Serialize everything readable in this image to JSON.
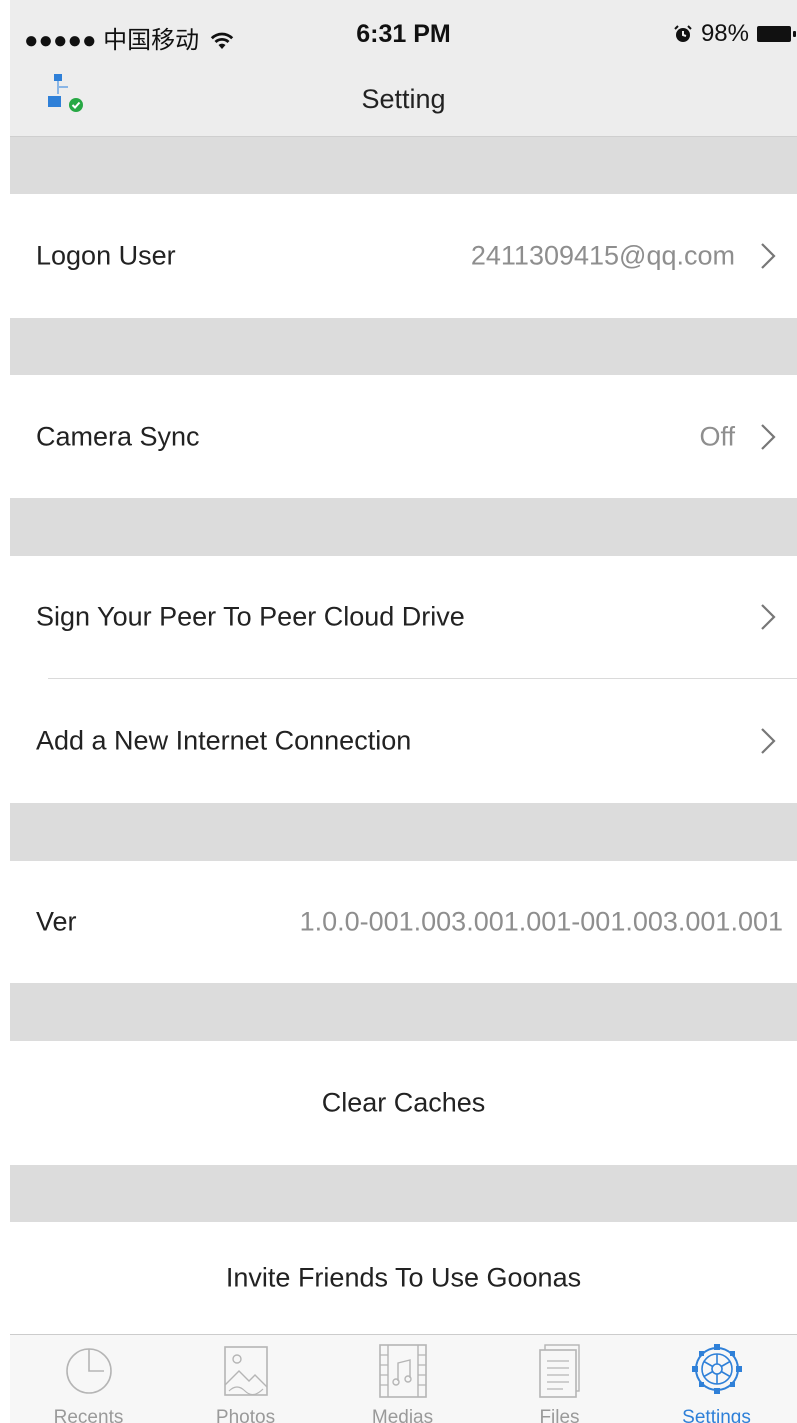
{
  "status_bar": {
    "carrier": "●●●●● 中国移动",
    "time": "6:31 PM",
    "battery": "98%"
  },
  "nav": {
    "title": "Setting"
  },
  "rows": {
    "logon_user": {
      "label": "Logon User",
      "value": "2411309415@qq.com"
    },
    "camera_sync": {
      "label": "Camera Sync",
      "value": "Off"
    },
    "sign_drive": {
      "label": "Sign Your Peer To Peer Cloud Drive"
    },
    "add_connection": {
      "label": "Add a New Internet Connection"
    },
    "version": {
      "label": "Ver",
      "value": "1.0.0-001.003.001.001-001.003.001.001"
    },
    "clear_caches": {
      "label": "Clear Caches"
    },
    "invite": {
      "label": "Invite Friends To Use Goonas"
    }
  },
  "tabs": [
    {
      "label": "Recents",
      "icon": "recents-clock-icon"
    },
    {
      "label": "Photos",
      "icon": "photos-image-icon"
    },
    {
      "label": "Medias",
      "icon": "medias-film-music-icon"
    },
    {
      "label": "Files",
      "icon": "files-document-icon"
    },
    {
      "label": "Settings",
      "icon": "settings-gear-icon",
      "active": true
    }
  ],
  "colors": {
    "accent": "#2f80d8",
    "separator": "#dcdcdc",
    "navbar": "#ededed",
    "secondary_text": "#8e8e8e"
  }
}
